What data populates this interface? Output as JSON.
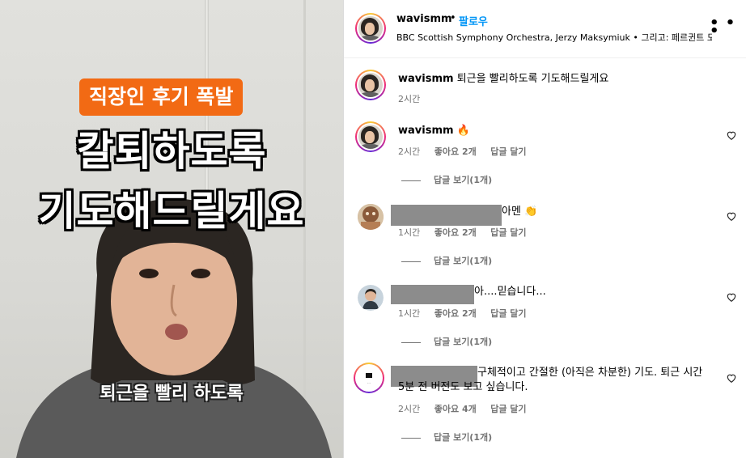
{
  "video": {
    "tag_text": "직장인 후기 폭발",
    "headline_line1": "칼퇴하도록",
    "headline_line2": "기도해드릴게요",
    "subtitle": "퇴근을 빨리 하도록"
  },
  "header": {
    "username": "wavismm",
    "separator": "•",
    "follow_label": "팔로우",
    "audio_info": "BBC Scottish Symphony Orchestra, Jerzy Maksymiuk • 그리고: 페르귄트 도",
    "more_icon": "more-horizontal-icon"
  },
  "caption": {
    "username": "wavismm",
    "text": "퇴근을 빨리하도록 기도해드릴게요",
    "time": "2시간"
  },
  "comments": [
    {
      "username": "wavismm",
      "text": "🔥",
      "time": "2시간",
      "likes": "좋아요 2개",
      "reply_label": "답글 달기",
      "view_replies": "답글 보기(1개)"
    },
    {
      "username": "",
      "text": "아멘 👏",
      "time": "1시간",
      "likes": "좋아요 2개",
      "reply_label": "답글 달기",
      "view_replies": "답글 보기(1개)"
    },
    {
      "username": "",
      "text": "아....믿습니다...",
      "time": "1시간",
      "likes": "좋아요 2개",
      "reply_label": "답글 달기",
      "view_replies": "답글 보기(1개)"
    },
    {
      "username": "",
      "text_line1": "구체적이고 간절한 (아직은 차분한) 기도. 퇴근 시간",
      "text_line2": "5분 전 버전도 보고 싶습니다.",
      "time": "2시간",
      "likes": "좋아요 4개",
      "reply_label": "답글 달기",
      "view_replies": "답글 보기(1개)"
    }
  ],
  "colors": {
    "accent": "#0095f6",
    "tag_bg": "#f26a14",
    "muted": "#737373"
  }
}
